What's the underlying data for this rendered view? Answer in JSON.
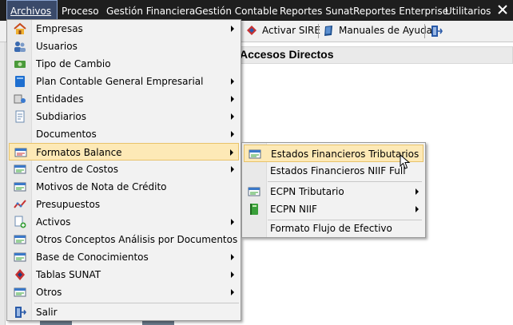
{
  "menubar": {
    "items": [
      {
        "label": "Archivos",
        "active": true
      },
      {
        "label": "Proceso"
      },
      {
        "label": "Gestión Financiera"
      },
      {
        "label": "Gestión Contable"
      },
      {
        "label": "Reportes Sunat"
      },
      {
        "label": "Reportes Enterprise"
      },
      {
        "label": "Utilitarios"
      }
    ]
  },
  "toolbar": {
    "sire_label": "Activar SIRE",
    "manuales_label": "Manuales de Ayuda"
  },
  "panel": {
    "title": "Accesos Directos"
  },
  "archivos_menu": {
    "items": [
      {
        "label": "Empresas",
        "icon": "house-icon",
        "submenu": true
      },
      {
        "label": "Usuarios",
        "icon": "users-icon",
        "submenu": false
      },
      {
        "label": "Tipo de Cambio",
        "icon": "money-icon",
        "submenu": false
      },
      {
        "label": "Plan Contable General Empresarial",
        "icon": "blue-book-icon",
        "submenu": true
      },
      {
        "label": "Entidades",
        "icon": "entities-icon",
        "submenu": true
      },
      {
        "label": "Subdiarios",
        "icon": "document-icon",
        "submenu": true
      },
      {
        "label": "Documentos",
        "icon": "",
        "submenu": true
      },
      {
        "label": "Formatos Balance",
        "icon": "form-icon",
        "submenu": true,
        "highlighted": true
      },
      {
        "label": "Centro de Costos",
        "icon": "form-icon",
        "submenu": true
      },
      {
        "label": "Motivos de Nota de Crédito",
        "icon": "form-icon",
        "submenu": false
      },
      {
        "label": "Presupuestos",
        "icon": "chart-icon",
        "submenu": false
      },
      {
        "label": "Activos",
        "icon": "assets-icon",
        "submenu": true
      },
      {
        "label": "Otros Conceptos Análisis por Documentos",
        "icon": "form-icon",
        "submenu": false
      },
      {
        "label": "Base de Conocimientos",
        "icon": "form-icon",
        "submenu": true
      },
      {
        "label": "Tablas SUNAT",
        "icon": "sunat-icon",
        "submenu": true
      },
      {
        "label": "Otros",
        "icon": "form-icon",
        "submenu": true
      },
      {
        "label": "Salir",
        "icon": "exit-icon",
        "submenu": false
      }
    ]
  },
  "formatos_submenu": {
    "items": [
      {
        "label": "Estados Financieros Tributarios",
        "icon": "form-icon",
        "submenu": false,
        "highlighted": true
      },
      {
        "label": "Estados Financieros NIIF Full",
        "icon": "",
        "submenu": false
      },
      {
        "label": "ECPN Tributario",
        "icon": "form-icon",
        "submenu": true
      },
      {
        "label": "ECPN NIIF",
        "icon": "green-book-icon",
        "submenu": true
      },
      {
        "label": "Formato Flujo de Efectivo",
        "icon": "",
        "submenu": false
      }
    ]
  },
  "colors": {
    "menubar_bg": "#1e1e1e",
    "highlight_bg": "#fde9b6",
    "highlight_border": "#e8c36a",
    "menu_bg": "#f2f2f2"
  }
}
